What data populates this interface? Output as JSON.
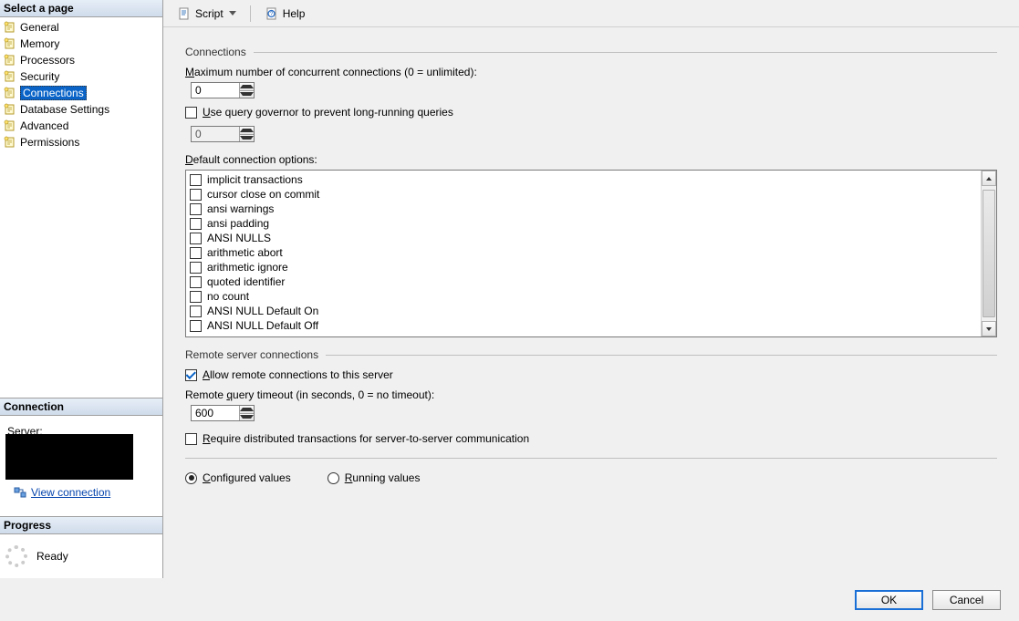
{
  "sidebar": {
    "header": "Select a page",
    "pages": [
      {
        "label": "General"
      },
      {
        "label": "Memory"
      },
      {
        "label": "Processors"
      },
      {
        "label": "Security"
      },
      {
        "label": "Connections",
        "selected": true
      },
      {
        "label": "Database Settings"
      },
      {
        "label": "Advanced"
      },
      {
        "label": "Permissions"
      }
    ],
    "connection": {
      "header": "Connection",
      "server_label": "Server:",
      "view_link": "View connection"
    },
    "progress": {
      "header": "Progress",
      "status": "Ready"
    }
  },
  "toolbar": {
    "script": "Script",
    "help": "Help"
  },
  "form": {
    "connections_group": "Connections",
    "max_conn_label": "Maximum number of concurrent connections (0 = unlimited):",
    "max_conn_value": "0",
    "governor_label": "Use query governor to prevent long-running queries",
    "governor_checked": false,
    "governor_value": "0",
    "default_opts_label": "Default connection options:",
    "options": [
      {
        "label": "implicit transactions",
        "checked": false
      },
      {
        "label": "cursor close on commit",
        "checked": false
      },
      {
        "label": "ansi warnings",
        "checked": false
      },
      {
        "label": "ansi padding",
        "checked": false
      },
      {
        "label": "ANSI NULLS",
        "checked": false
      },
      {
        "label": "arithmetic abort",
        "checked": false
      },
      {
        "label": "arithmetic ignore",
        "checked": false
      },
      {
        "label": "quoted identifier",
        "checked": false
      },
      {
        "label": "no count",
        "checked": false
      },
      {
        "label": "ANSI NULL Default On",
        "checked": false
      },
      {
        "label": "ANSI NULL Default Off",
        "checked": false
      }
    ],
    "remote_group": "Remote server connections",
    "allow_remote_label": "Allow remote connections to this server",
    "allow_remote_checked": true,
    "remote_timeout_label": "Remote query timeout (in seconds, 0 = no timeout):",
    "remote_timeout_value": "600",
    "distributed_label": "Require distributed transactions for server-to-server communication",
    "distributed_checked": false,
    "configured_label": "Configured values",
    "running_label": "Running values"
  },
  "buttons": {
    "ok": "OK",
    "cancel": "Cancel"
  }
}
